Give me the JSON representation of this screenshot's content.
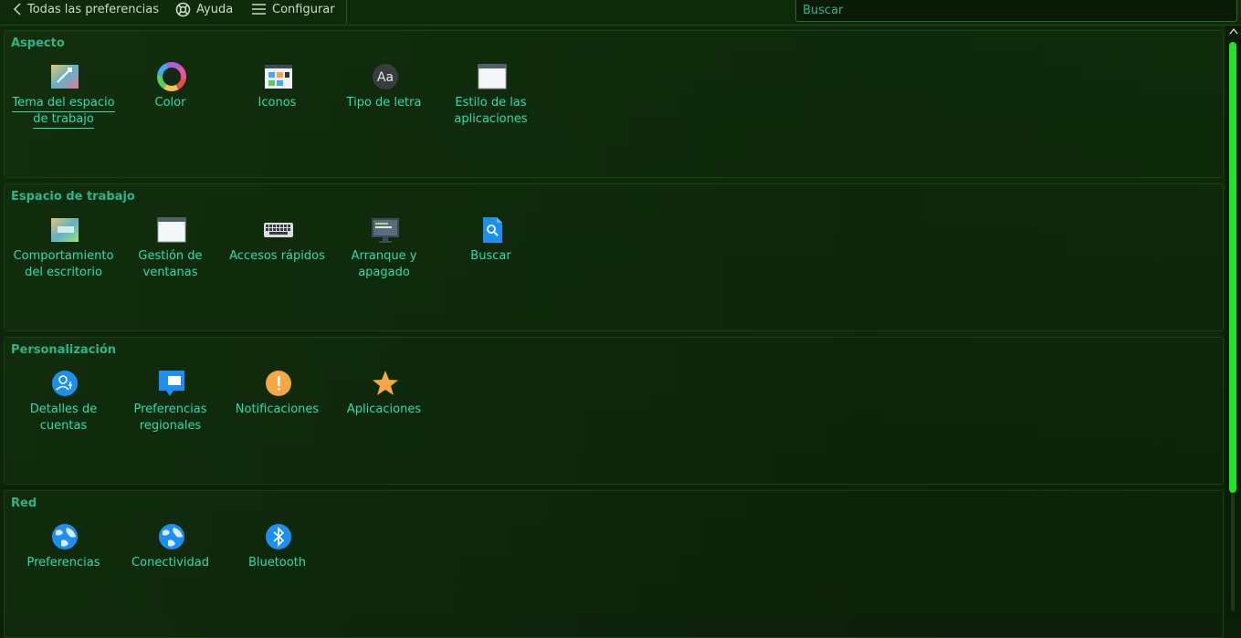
{
  "toolbar": {
    "back_label": "Todas las preferencias",
    "help_label": "Ayuda",
    "configure_label": "Configurar",
    "search_placeholder": "Buscar"
  },
  "sections": [
    {
      "title": "Aspecto",
      "items": [
        {
          "label": "Tema del espacio de trabajo",
          "icon": "workspace-theme-icon"
        },
        {
          "label": "Color",
          "icon": "color-wheel-icon"
        },
        {
          "label": "Iconos",
          "icon": "icons-icon"
        },
        {
          "label": "Tipo de letra",
          "icon": "font-icon"
        },
        {
          "label": "Estilo de las aplicaciones",
          "icon": "app-style-icon"
        }
      ]
    },
    {
      "title": "Espacio de trabajo",
      "items": [
        {
          "label": "Comportamiento del escritorio",
          "icon": "desktop-behavior-icon"
        },
        {
          "label": "Gestión de ventanas",
          "icon": "window-management-icon"
        },
        {
          "label": "Accesos rápidos",
          "icon": "keyboard-icon"
        },
        {
          "label": "Arranque y apagado",
          "icon": "startup-shutdown-icon"
        },
        {
          "label": "Buscar",
          "icon": "search-file-icon"
        }
      ]
    },
    {
      "title": "Personalización",
      "items": [
        {
          "label": "Detalles de cuentas",
          "icon": "account-icon"
        },
        {
          "label": "Preferencias regionales",
          "icon": "regional-icon"
        },
        {
          "label": "Notificaciones",
          "icon": "notification-icon"
        },
        {
          "label": "Aplicaciones",
          "icon": "star-icon"
        }
      ]
    },
    {
      "title": "Red",
      "items": [
        {
          "label": "Preferencias",
          "icon": "globe-icon"
        },
        {
          "label": "Conectividad",
          "icon": "globe-icon"
        },
        {
          "label": "Bluetooth",
          "icon": "bluetooth-icon"
        }
      ]
    }
  ]
}
